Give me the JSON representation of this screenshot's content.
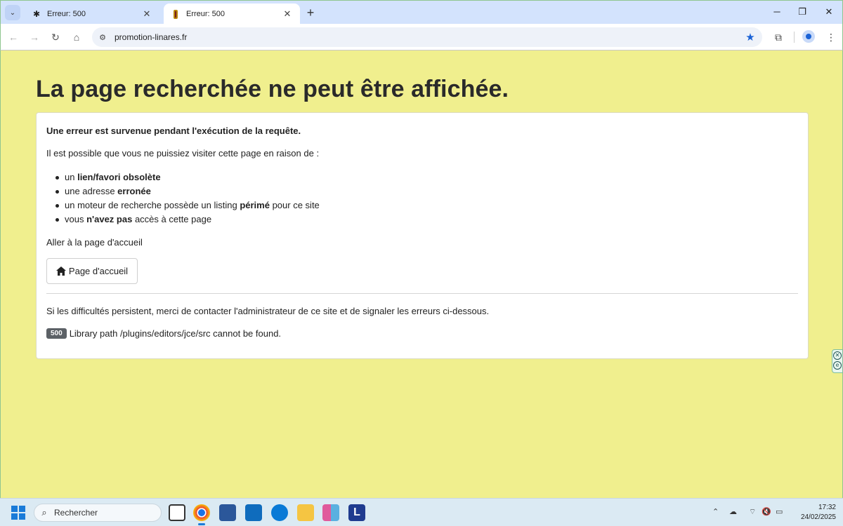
{
  "browser": {
    "tabs": [
      {
        "title": "Erreur: 500",
        "active": false
      },
      {
        "title": "Erreur: 500",
        "active": true
      }
    ],
    "url": "promotion-linares.fr"
  },
  "page": {
    "heading": "La page recherchée ne peut être affichée.",
    "lead": "Une erreur est survenue pendant l'exécution de la requête.",
    "intro": "Il est possible que vous ne puissiez visiter cette page en raison de :",
    "reasons": [
      {
        "before": "un ",
        "bold": "lien/favori obsolète",
        "after": ""
      },
      {
        "before": "une adresse ",
        "bold": "erronée",
        "after": ""
      },
      {
        "before": "un moteur de recherche possède un listing ",
        "bold": "périmé",
        "after": " pour ce site"
      },
      {
        "before": "vous ",
        "bold": "n'avez pas",
        "after": " accès à cette page"
      }
    ],
    "home_prompt": "Aller à la page d'accueil",
    "home_button": "Page d'accueil",
    "persist_text": "Si les difficultés persistent, merci de contacter l'administrateur de ce site et de signaler les erreurs ci-dessous.",
    "error_code": "500",
    "error_message": "Library path /plugins/editors/jce/src cannot be found."
  },
  "taskbar": {
    "search_placeholder": "Rechercher",
    "time": "17:32",
    "date": "24/02/2025"
  },
  "colors": {
    "page_background": "#f0ef8e",
    "accent_blue": "#1a62d6",
    "badge": "#5c6166"
  }
}
